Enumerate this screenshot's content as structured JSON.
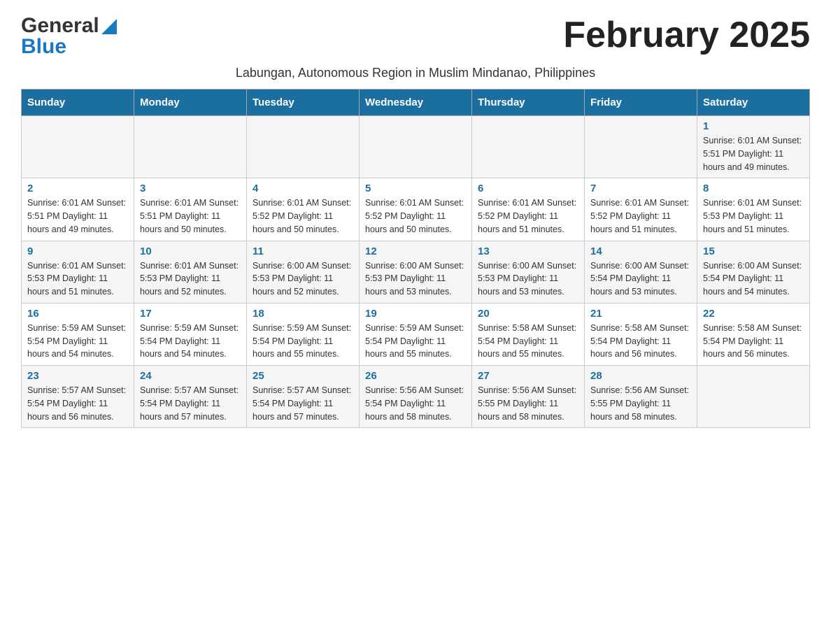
{
  "header": {
    "logo_general": "General",
    "logo_blue": "Blue",
    "month_title": "February 2025",
    "subtitle": "Labungan, Autonomous Region in Muslim Mindanao, Philippines"
  },
  "weekdays": [
    "Sunday",
    "Monday",
    "Tuesday",
    "Wednesday",
    "Thursday",
    "Friday",
    "Saturday"
  ],
  "weeks": [
    [
      {
        "day": "",
        "info": ""
      },
      {
        "day": "",
        "info": ""
      },
      {
        "day": "",
        "info": ""
      },
      {
        "day": "",
        "info": ""
      },
      {
        "day": "",
        "info": ""
      },
      {
        "day": "",
        "info": ""
      },
      {
        "day": "1",
        "info": "Sunrise: 6:01 AM\nSunset: 5:51 PM\nDaylight: 11 hours and 49 minutes."
      }
    ],
    [
      {
        "day": "2",
        "info": "Sunrise: 6:01 AM\nSunset: 5:51 PM\nDaylight: 11 hours and 49 minutes."
      },
      {
        "day": "3",
        "info": "Sunrise: 6:01 AM\nSunset: 5:51 PM\nDaylight: 11 hours and 50 minutes."
      },
      {
        "day": "4",
        "info": "Sunrise: 6:01 AM\nSunset: 5:52 PM\nDaylight: 11 hours and 50 minutes."
      },
      {
        "day": "5",
        "info": "Sunrise: 6:01 AM\nSunset: 5:52 PM\nDaylight: 11 hours and 50 minutes."
      },
      {
        "day": "6",
        "info": "Sunrise: 6:01 AM\nSunset: 5:52 PM\nDaylight: 11 hours and 51 minutes."
      },
      {
        "day": "7",
        "info": "Sunrise: 6:01 AM\nSunset: 5:52 PM\nDaylight: 11 hours and 51 minutes."
      },
      {
        "day": "8",
        "info": "Sunrise: 6:01 AM\nSunset: 5:53 PM\nDaylight: 11 hours and 51 minutes."
      }
    ],
    [
      {
        "day": "9",
        "info": "Sunrise: 6:01 AM\nSunset: 5:53 PM\nDaylight: 11 hours and 51 minutes."
      },
      {
        "day": "10",
        "info": "Sunrise: 6:01 AM\nSunset: 5:53 PM\nDaylight: 11 hours and 52 minutes."
      },
      {
        "day": "11",
        "info": "Sunrise: 6:00 AM\nSunset: 5:53 PM\nDaylight: 11 hours and 52 minutes."
      },
      {
        "day": "12",
        "info": "Sunrise: 6:00 AM\nSunset: 5:53 PM\nDaylight: 11 hours and 53 minutes."
      },
      {
        "day": "13",
        "info": "Sunrise: 6:00 AM\nSunset: 5:53 PM\nDaylight: 11 hours and 53 minutes."
      },
      {
        "day": "14",
        "info": "Sunrise: 6:00 AM\nSunset: 5:54 PM\nDaylight: 11 hours and 53 minutes."
      },
      {
        "day": "15",
        "info": "Sunrise: 6:00 AM\nSunset: 5:54 PM\nDaylight: 11 hours and 54 minutes."
      }
    ],
    [
      {
        "day": "16",
        "info": "Sunrise: 5:59 AM\nSunset: 5:54 PM\nDaylight: 11 hours and 54 minutes."
      },
      {
        "day": "17",
        "info": "Sunrise: 5:59 AM\nSunset: 5:54 PM\nDaylight: 11 hours and 54 minutes."
      },
      {
        "day": "18",
        "info": "Sunrise: 5:59 AM\nSunset: 5:54 PM\nDaylight: 11 hours and 55 minutes."
      },
      {
        "day": "19",
        "info": "Sunrise: 5:59 AM\nSunset: 5:54 PM\nDaylight: 11 hours and 55 minutes."
      },
      {
        "day": "20",
        "info": "Sunrise: 5:58 AM\nSunset: 5:54 PM\nDaylight: 11 hours and 55 minutes."
      },
      {
        "day": "21",
        "info": "Sunrise: 5:58 AM\nSunset: 5:54 PM\nDaylight: 11 hours and 56 minutes."
      },
      {
        "day": "22",
        "info": "Sunrise: 5:58 AM\nSunset: 5:54 PM\nDaylight: 11 hours and 56 minutes."
      }
    ],
    [
      {
        "day": "23",
        "info": "Sunrise: 5:57 AM\nSunset: 5:54 PM\nDaylight: 11 hours and 56 minutes."
      },
      {
        "day": "24",
        "info": "Sunrise: 5:57 AM\nSunset: 5:54 PM\nDaylight: 11 hours and 57 minutes."
      },
      {
        "day": "25",
        "info": "Sunrise: 5:57 AM\nSunset: 5:54 PM\nDaylight: 11 hours and 57 minutes."
      },
      {
        "day": "26",
        "info": "Sunrise: 5:56 AM\nSunset: 5:54 PM\nDaylight: 11 hours and 58 minutes."
      },
      {
        "day": "27",
        "info": "Sunrise: 5:56 AM\nSunset: 5:55 PM\nDaylight: 11 hours and 58 minutes."
      },
      {
        "day": "28",
        "info": "Sunrise: 5:56 AM\nSunset: 5:55 PM\nDaylight: 11 hours and 58 minutes."
      },
      {
        "day": "",
        "info": ""
      }
    ]
  ]
}
